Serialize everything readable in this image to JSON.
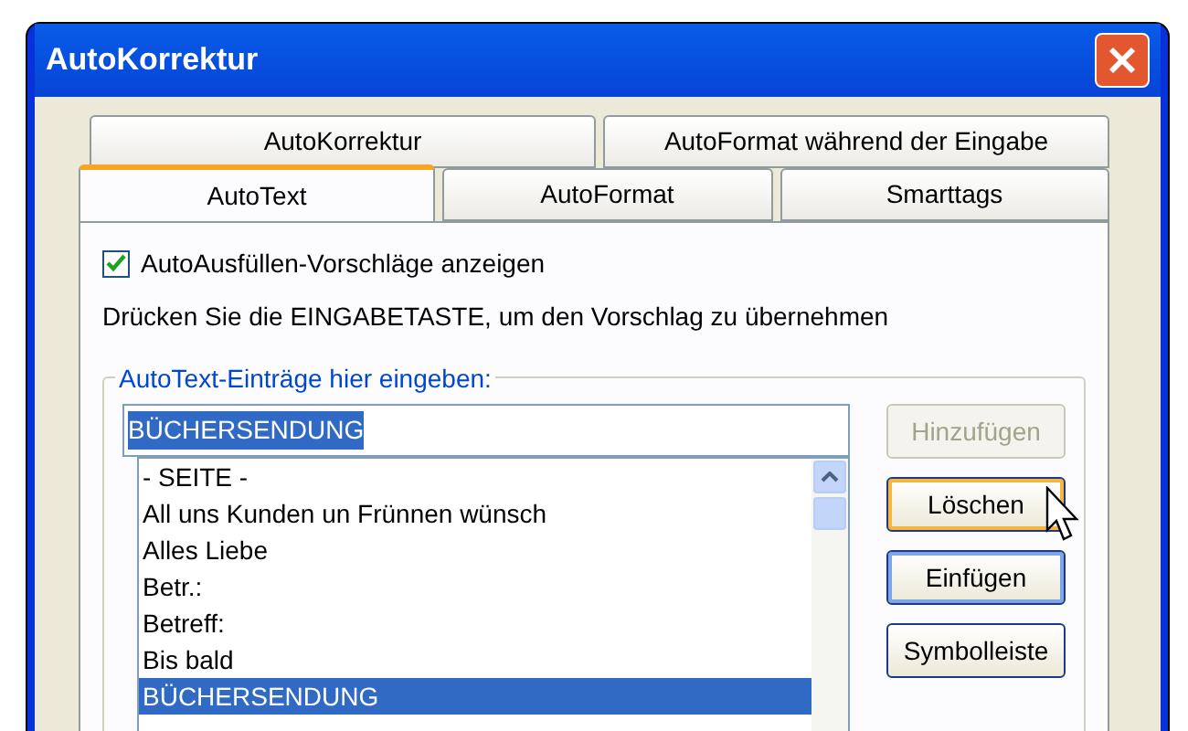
{
  "window": {
    "title": "AutoKorrektur"
  },
  "tab_rows": [
    [
      {
        "label": "AutoKorrektur",
        "selected": false
      },
      {
        "label": "AutoFormat während der Eingabe",
        "selected": false
      }
    ],
    [
      {
        "label": "AutoText",
        "selected": true
      },
      {
        "label": "AutoFormat",
        "selected": false
      },
      {
        "label": "Smarttags",
        "selected": false
      }
    ]
  ],
  "autofill_checkbox": {
    "label": "AutoAusfüllen-Vorschläge anzeigen",
    "checked": true
  },
  "hint": "Drücken Sie die EINGABETASTE, um den Vorschlag zu übernehmen",
  "group": {
    "label": "AutoText-Einträge hier eingeben:",
    "entry_field": {
      "value": "BÜCHERSENDUNG"
    },
    "entries": [
      {
        "label": "- SEITE -",
        "selected": false
      },
      {
        "label": "All uns Kunden un Frünnen wünsch",
        "selected": false
      },
      {
        "label": "Alles Liebe",
        "selected": false
      },
      {
        "label": "Betr.:",
        "selected": false
      },
      {
        "label": "Betreff:",
        "selected": false
      },
      {
        "label": "Bis bald",
        "selected": false
      },
      {
        "label": "BÜCHERSENDUNG",
        "selected": true
      }
    ],
    "buttons": [
      {
        "label": "Hinzufügen",
        "kind": "disabled"
      },
      {
        "label": "Löschen",
        "kind": "hover"
      },
      {
        "label": "Einfügen",
        "kind": "default"
      },
      {
        "label": "Symbolleiste",
        "kind": "normal"
      }
    ]
  }
}
